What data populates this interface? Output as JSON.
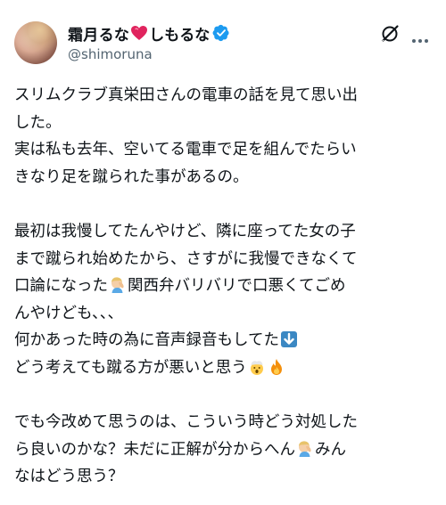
{
  "author": {
    "display_name": "霜月るな",
    "display_name_suffix": "しもるな",
    "handle": "@shimoruna",
    "heart_color": "#e0245e",
    "verified_color": "#1d9bf0"
  },
  "icons": {
    "verified": "verified-badge-icon",
    "grok": "grok-icon",
    "more": "more-icon",
    "heart": "heart-icon"
  },
  "tweet": {
    "p1_l1": "スリムクラブ真栄田さんの電車の話を見て思い出",
    "p1_l2": "した。",
    "p1_l3": "実は私も去年、空いてる電車で足を組んでたらい",
    "p1_l4": "きなり足を蹴られた事があるの。",
    "p2_l1": "最初は我慢してたんやけど、隣に座ってた女の子",
    "p2_l2": "まで蹴られ始めたから、さすがに我慢できなくて",
    "p2_l3a": "口論になった",
    "p2_l3b": "関西弁バリバリで口悪くてごめ",
    "p2_l4": "んやけども、、、",
    "p2_l5": "何かあった時の為に音声録音もしてた",
    "p2_l6": "どう考えても蹴る方が悪いと思う",
    "p3_l1": "でも今改めて思うのは、こういう時どう対処した",
    "p3_l2a": "ら良いのかな？未だに正解が分からへん",
    "p3_l2b": "みん",
    "p3_l3": "なはどう思う？"
  }
}
